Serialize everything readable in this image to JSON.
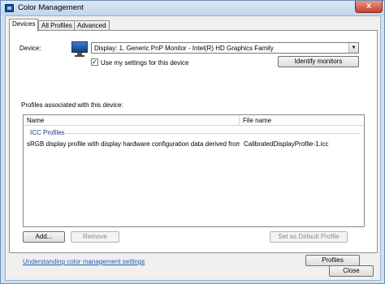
{
  "window": {
    "title": "Color Management",
    "close_glyph": "x"
  },
  "tabs": [
    {
      "label": "Devices",
      "active": true
    },
    {
      "label": "All Profiles",
      "active": false
    },
    {
      "label": "Advanced",
      "active": false
    }
  ],
  "device": {
    "label": "Device:",
    "selected": "Display: 1. Generic PnP Monitor - Intel(R) HD Graphics Family",
    "icon": "monitor-icon",
    "use_my_settings_label": "Use my settings for this device",
    "use_my_settings_checked": true,
    "identify_button": "Identify monitors"
  },
  "profiles": {
    "section_label": "Profiles associated with this device:",
    "columns": [
      "Name",
      "File name"
    ],
    "group": "ICC Profiles",
    "rows": [
      {
        "name": "sRGB display profile with display hardware configuration data derived from cali...",
        "file": "CalibratedDisplayProfile-1.icc"
      }
    ],
    "add_button": "Add...",
    "remove_button": "Remove",
    "default_button": "Set as Default Profile"
  },
  "footer": {
    "link": "Understanding color management settings",
    "profiles_button": "Profiles",
    "close_button": "Close"
  }
}
